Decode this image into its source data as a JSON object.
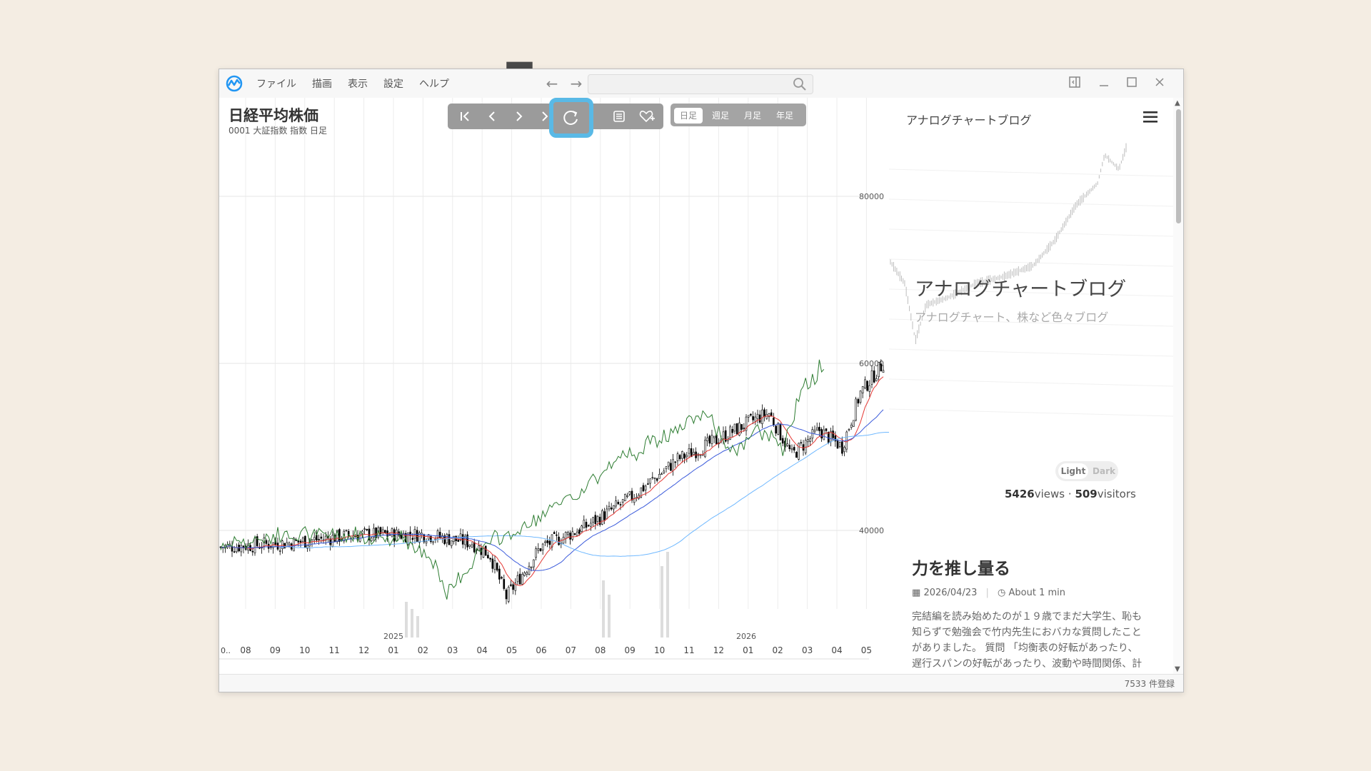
{
  "step_number": "5",
  "menu": [
    "ファイル",
    "描画",
    "表示",
    "設定",
    "ヘルプ"
  ],
  "search": {
    "placeholder": ""
  },
  "chart": {
    "title": "日経平均株価",
    "subtitle": "0001 大証指数 指数 日足",
    "y_ticks": [
      "80000",
      "60000",
      "40000"
    ],
    "month_labels": [
      "08",
      "09",
      "10",
      "11",
      "12",
      "01",
      "02",
      "03",
      "04",
      "05",
      "06",
      "07",
      "08",
      "09",
      "10",
      "11",
      "12",
      "01",
      "02",
      "03",
      "04",
      "05"
    ],
    "year_labels": [
      "2025",
      "2026"
    ],
    "left_edge_label": "0.."
  },
  "toolbar": {
    "buttons": [
      "first-icon",
      "prev-icon",
      "next-icon",
      "last-icon",
      "refresh-icon",
      "list-icon",
      "favorite-add-icon"
    ]
  },
  "period": {
    "labels": [
      "日足",
      "週足",
      "月足",
      "年足"
    ],
    "active": "日足"
  },
  "blog": {
    "site_name": "アナログチャートブログ",
    "hero_title": "アナログチャートブログ",
    "hero_subtitle": "アナログチャート、株など色々ブログ",
    "toggle_light": "Light",
    "toggle_dark": "Dark",
    "views_count": "5426",
    "views_label": "views",
    "visitors_count": "509",
    "visitors_label": "visitors",
    "post_title": "力を推し量る",
    "post_date": "2026/04/23",
    "post_read_time": "About 1 min",
    "post_body": "完結編を読み始めたのが１９歳でまだ大学生、恥も知らずで勉強会で竹内先生におバカな質問したことがありました。 質問 「均衡表の好転があったり、遅行スパンの好転があったり、波動や時間関係、計"
  },
  "status": {
    "record_count": "7533 件登録"
  },
  "colors": {
    "accent": "#59b9e6",
    "candle": "#000000",
    "line_green": "#2e7d32",
    "line_red": "#e53935",
    "line_blue": "#3b5bdb",
    "line_lightblue": "#6fb8ff"
  }
}
